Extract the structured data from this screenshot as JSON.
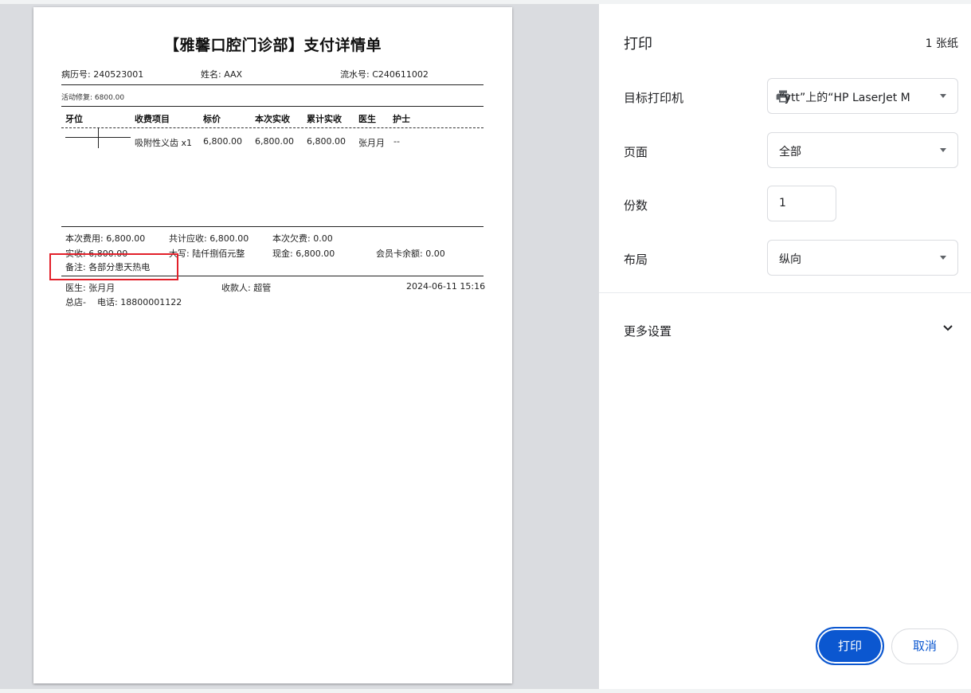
{
  "receipt": {
    "title": "【雅馨口腔门诊部】支付详情单",
    "record_no": "病历号: 240523001",
    "patient_name": "姓名: AAX",
    "serial_no": "流水号: C240611002",
    "activity": "活动修复: 6800.00",
    "table": {
      "headers": [
        "牙位",
        "收费项目",
        "标价",
        "本次实收",
        "累计实收",
        "医生",
        "护士"
      ],
      "rows": [
        [
          "",
          "吸附性义齿 x1",
          "6,800.00",
          "6,800.00",
          "6,800.00",
          "张月月",
          "--"
        ]
      ]
    },
    "summary": {
      "current_fee": "本次费用: 6,800.00",
      "total_due": "共计应收: 6,800.00",
      "current_debt": "本次欠费: 0.00",
      "received": "实收: 6,800.00",
      "uppercase": "大写: 陆仟捌佰元整",
      "cash": "现金: 6,800.00",
      "member_balance": "会员卡余额: 0.00",
      "note": "备注: 各部分患天热电"
    },
    "footer": {
      "doctor": "医生: 张月月",
      "cashier": "收款人: 超管",
      "datetime": "2024-06-11 15:16",
      "branch": "总店-",
      "phone": "电话: 18800001122"
    }
  },
  "print_panel": {
    "title": "打印",
    "sheets": "1 张纸",
    "printer_label": "目标打印机",
    "printer_value": "“ytt”上的“HP LaserJet M",
    "printer_icon": "printer-icon",
    "pages_label": "页面",
    "pages_value": "全部",
    "copies_label": "份数",
    "copies_value": "1",
    "layout_label": "布局",
    "layout_value": "纵向",
    "more_settings": "更多设置",
    "print_button": "打印",
    "cancel_button": "取消",
    "accent_color": "#0b57d0",
    "highlight_color": "#e2202a"
  }
}
